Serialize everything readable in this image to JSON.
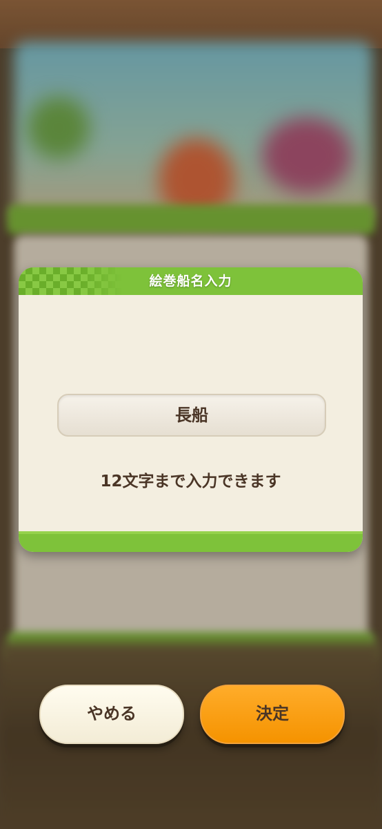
{
  "dialog": {
    "title": "絵巻船名入力",
    "name_value": "長船",
    "hint": "12文字まで入力できます"
  },
  "buttons": {
    "cancel_label": "やめる",
    "confirm_label": "決定"
  },
  "colors": {
    "header_green": "#7ec23a",
    "dialog_bg": "#f3eee0",
    "confirm_orange": "#f59300",
    "text_brown": "#4a3526"
  }
}
